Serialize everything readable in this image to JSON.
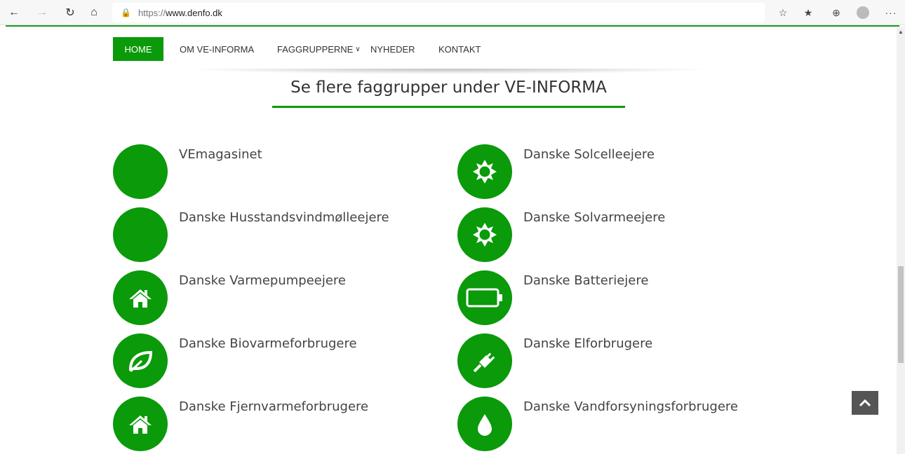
{
  "browser": {
    "url_scheme": "https://",
    "url_host": "www.denfo.dk"
  },
  "nav": {
    "items": [
      {
        "label": "HOME"
      },
      {
        "label": "OM VE-INFORMA"
      },
      {
        "label": "FAGGRUPPERNE"
      },
      {
        "label": "NYHEDER"
      },
      {
        "label": "KONTAKT"
      }
    ]
  },
  "section": {
    "heading": "Se flere faggrupper under VE-INFORMA"
  },
  "groups": [
    {
      "label": "VEmagasinet",
      "icon": "blank-circle-icon"
    },
    {
      "label": "Danske Solcelleejere",
      "icon": "sun-icon"
    },
    {
      "label": "Danske Husstandsvindmølleejere",
      "icon": "blank-circle-icon"
    },
    {
      "label": "Danske Solvarmeejere",
      "icon": "sun-icon"
    },
    {
      "label": "Danske Varmepumpeejere",
      "icon": "home-icon"
    },
    {
      "label": "Danske Batteriejere",
      "icon": "battery-icon"
    },
    {
      "label": "Danske Biovarmeforbrugere",
      "icon": "leaf-icon"
    },
    {
      "label": "Danske Elforbrugere",
      "icon": "plug-icon"
    },
    {
      "label": "Danske Fjernvarmeforbrugere",
      "icon": "home-icon"
    },
    {
      "label": "Danske Vandforsyningsforbrugere",
      "icon": "water-drop-icon"
    }
  ],
  "colors": {
    "accent": "#0a9a0a",
    "text": "#444444"
  }
}
